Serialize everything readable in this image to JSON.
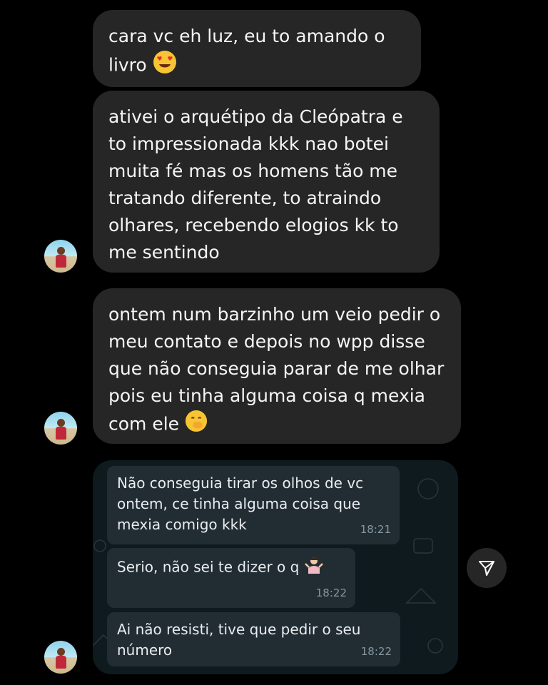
{
  "messages": [
    {
      "text": "cara vc eh luz, eu to amando o livro",
      "emoji": "heart-eyes"
    },
    {
      "text": "ativei o arquétipo da Cleópatra e to impressionada kkk nao botei muita fé mas os homens tão me tratando diferente, to atraindo olhares, recebendo elogios kk to me sentindo"
    },
    {
      "text": "ontem num barzinho um veio pedir o meu contato e depois no wpp disse que não conseguia parar de me olhar pois eu tinha alguma coisa q mexia com ele",
      "emoji": "hand-over-mouth"
    }
  ],
  "shared_chat": {
    "messages": [
      {
        "text": "Não conseguia tirar os olhos de vc ontem, ce tinha alguma coisa que mexia comigo kkk",
        "time": "18:21"
      },
      {
        "text": "Serio, não sei te dizer o q",
        "time": "18:22",
        "emoji": "person-shrugging"
      },
      {
        "text": "Ai não resisti, tive que pedir o seu número",
        "time": "18:22"
      }
    ]
  },
  "icons": {
    "share": "paper-plane-icon",
    "avatar": "profile-avatar"
  },
  "colors": {
    "background": "#000000",
    "bubble": "#262626",
    "wa_bubble": "#222d33",
    "wa_time": "#8696a0"
  }
}
